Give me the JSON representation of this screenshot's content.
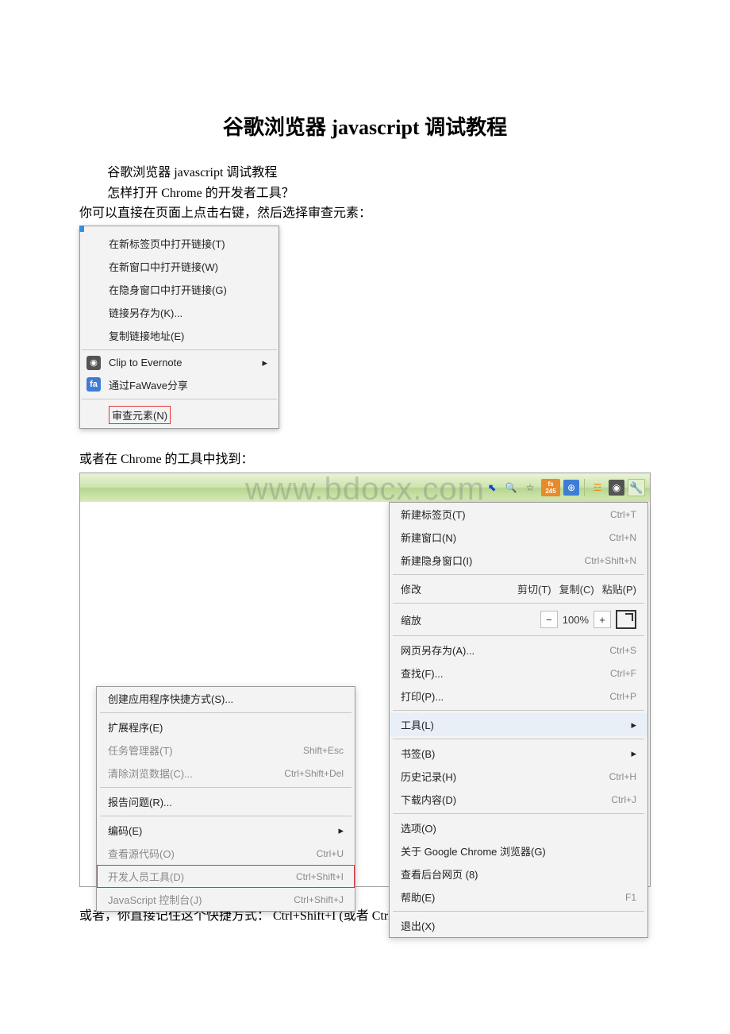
{
  "doc": {
    "title": "谷歌浏览器 javascript 调试教程",
    "p1": "谷歌浏览器 javascript 调试教程",
    "p2": "怎样打开 Chrome 的开发者工具？",
    "p3": "你可以直接在页面上点击右键，然后选择审查元素：",
    "p4": "或者在 Chrome 的工具中找到：",
    "p5": "或者，你直接记住这个快捷方式： Ctrl+Shift+I (或者 Ctrl+Shift+J 直接打开控制台)，或"
  },
  "watermark": "www.bdocx.com",
  "context_menu": {
    "open_in_tab": "在新标签页中打开链接(T)",
    "open_in_window": "在新窗口中打开链接(W)",
    "open_incognito": "在隐身窗口中打开链接(G)",
    "save_link_as": "链接另存为(K)...",
    "copy_link": "复制链接地址(E)",
    "clip_evernote": "Clip to Evernote",
    "fawave_share": "通过FaWave分享",
    "inspect": "审查元素(N)"
  },
  "toolbar_icons": {
    "selector": "⬉",
    "magnify": "🔍",
    "star": "☆",
    "count_label": "fs\n245",
    "globe": "⊕",
    "fire": "☲",
    "evernote": "◉",
    "wrench": "🔧"
  },
  "main_menu": {
    "new_tab": {
      "label": "新建标签页(T)",
      "sc": "Ctrl+T"
    },
    "new_window": {
      "label": "新建窗口(N)",
      "sc": "Ctrl+N"
    },
    "new_incognito": {
      "label": "新建隐身窗口(I)",
      "sc": "Ctrl+Shift+N"
    },
    "edit_row": {
      "label": "修改",
      "cut": "剪切(T)",
      "copy": "复制(C)",
      "paste": "粘贴(P)"
    },
    "zoom_row": {
      "label": "缩放",
      "value": "100%"
    },
    "save_page": {
      "label": "网页另存为(A)...",
      "sc": "Ctrl+S"
    },
    "find": {
      "label": "查找(F)...",
      "sc": "Ctrl+F"
    },
    "print": {
      "label": "打印(P)...",
      "sc": "Ctrl+P"
    },
    "tools": {
      "label": "工具(L)"
    },
    "bookmarks": {
      "label": "书签(B)"
    },
    "history": {
      "label": "历史记录(H)",
      "sc": "Ctrl+H"
    },
    "downloads": {
      "label": "下载内容(D)",
      "sc": "Ctrl+J"
    },
    "options": {
      "label": "选项(O)"
    },
    "about": {
      "label": "关于 Google Chrome 浏览器(G)"
    },
    "bg_pages": {
      "label": "查看后台网页 (8)"
    },
    "help": {
      "label": "帮助(E)",
      "sc": "F1"
    },
    "exit": {
      "label": "退出(X)"
    }
  },
  "tools_submenu": {
    "create_shortcut": {
      "label": "创建应用程序快捷方式(S)..."
    },
    "extensions": {
      "label": "扩展程序(E)"
    },
    "task_manager": {
      "label": "任务管理器(T)",
      "sc": "Shift+Esc"
    },
    "clear_data": {
      "label": "清除浏览数据(C)...",
      "sc": "Ctrl+Shift+Del"
    },
    "report_issue": {
      "label": "报告问题(R)..."
    },
    "encoding": {
      "label": "编码(E)"
    },
    "view_source": {
      "label": "查看源代码(O)",
      "sc": "Ctrl+U"
    },
    "dev_tools": {
      "label": "开发人员工具(D)",
      "sc": "Ctrl+Shift+I"
    },
    "js_console": {
      "label": "JavaScript 控制台(J)",
      "sc": "Ctrl+Shift+J"
    }
  }
}
